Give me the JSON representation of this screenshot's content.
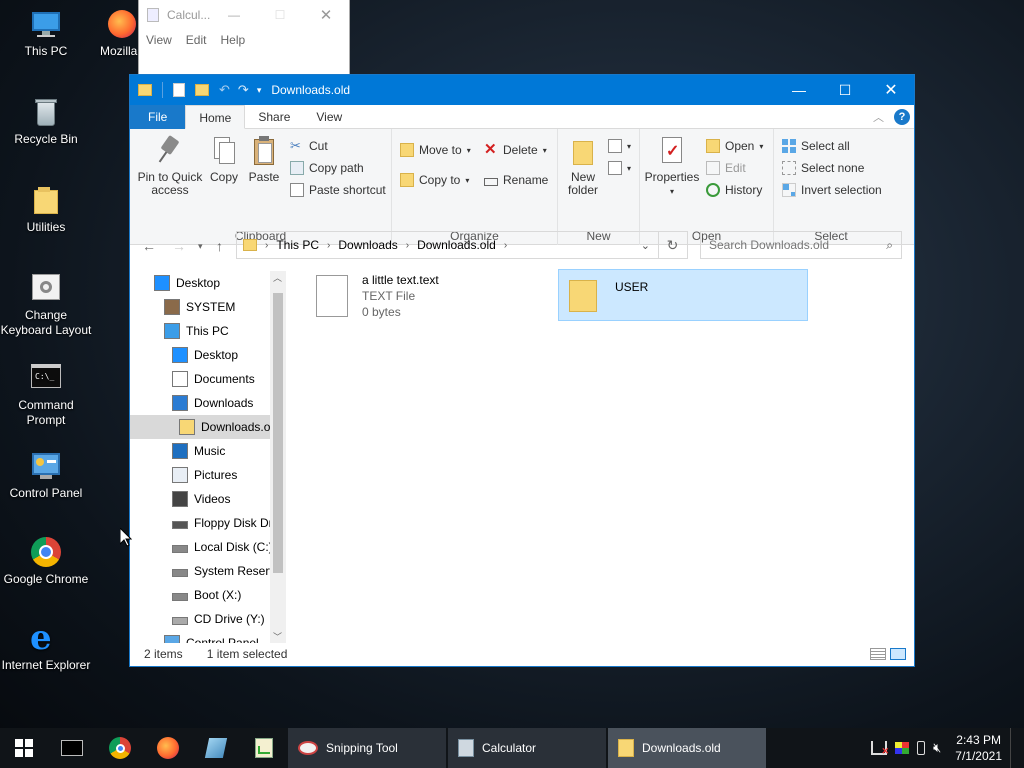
{
  "desktop": {
    "icons": [
      {
        "label": "This PC",
        "icon": "this-pc-icon"
      },
      {
        "label": "Recycle Bin",
        "icon": "recycle-bin-icon"
      },
      {
        "label": "Utilities",
        "icon": "folder-icon"
      },
      {
        "label": "Change Keyboard Layout",
        "icon": "keyboard-settings-icon"
      },
      {
        "label": "Command Prompt",
        "icon": "command-prompt-icon"
      },
      {
        "label": "Control Panel",
        "icon": "control-panel-icon"
      },
      {
        "label": "Google Chrome",
        "icon": "chrome-icon"
      },
      {
        "label": "Internet Explorer",
        "icon": "internet-explorer-icon"
      },
      {
        "label": "Mozilla",
        "icon": "firefox-icon"
      }
    ]
  },
  "calculator_window": {
    "title": "Calcul...",
    "menu": [
      "View",
      "Edit",
      "Help"
    ]
  },
  "explorer": {
    "title": "Downloads.old",
    "tabs": [
      "File",
      "Home",
      "Share",
      "View"
    ],
    "ribbon": {
      "clipboard": {
        "label": "Clipboard",
        "pin": "Pin to Quick access",
        "copy": "Copy",
        "paste": "Paste",
        "cut": "Cut",
        "copy_path": "Copy path",
        "paste_shortcut": "Paste shortcut"
      },
      "organize": {
        "label": "Organize",
        "move_to": "Move to",
        "copy_to": "Copy to",
        "delete": "Delete",
        "rename": "Rename"
      },
      "new": {
        "label": "New",
        "new_folder": "New folder"
      },
      "open": {
        "label": "Open",
        "properties": "Properties",
        "open": "Open",
        "edit": "Edit",
        "history": "History"
      },
      "select": {
        "label": "Select",
        "select_all": "Select all",
        "select_none": "Select none",
        "invert": "Invert selection"
      }
    },
    "address": {
      "crumbs": [
        "This PC",
        "Downloads",
        "Downloads.old"
      ],
      "search_placeholder": "Search Downloads.old"
    },
    "nav": [
      {
        "label": "Desktop",
        "indent": 0,
        "icon": "desktop-icon"
      },
      {
        "label": "SYSTEM",
        "indent": 1,
        "icon": "user-icon"
      },
      {
        "label": "This PC",
        "indent": 1,
        "icon": "this-pc-icon"
      },
      {
        "label": "Desktop",
        "indent": 2,
        "icon": "desktop-icon"
      },
      {
        "label": "Documents",
        "indent": 2,
        "icon": "documents-icon"
      },
      {
        "label": "Downloads",
        "indent": 2,
        "icon": "downloads-icon"
      },
      {
        "label": "Downloads.o",
        "indent": 3,
        "icon": "folder-icon",
        "selected": true
      },
      {
        "label": "Music",
        "indent": 2,
        "icon": "music-icon"
      },
      {
        "label": "Pictures",
        "indent": 2,
        "icon": "pictures-icon"
      },
      {
        "label": "Videos",
        "indent": 2,
        "icon": "videos-icon"
      },
      {
        "label": "Floppy Disk Dri",
        "indent": 2,
        "icon": "floppy-icon"
      },
      {
        "label": "Local Disk (C:)",
        "indent": 2,
        "icon": "drive-icon"
      },
      {
        "label": "System Reserve",
        "indent": 2,
        "icon": "drive-icon"
      },
      {
        "label": "Boot (X:)",
        "indent": 2,
        "icon": "drive-icon"
      },
      {
        "label": "CD Drive (Y:)",
        "indent": 2,
        "icon": "cd-drive-icon"
      },
      {
        "label": "Control Panel",
        "indent": 1,
        "icon": "control-panel-icon"
      }
    ],
    "files": [
      {
        "name": "a little text.text",
        "type": "TEXT File",
        "size": "0 bytes",
        "icon": "text-file-icon"
      },
      {
        "name": "USER",
        "type": "",
        "size": "",
        "icon": "folder-icon",
        "selected": true
      }
    ],
    "status": {
      "items": "2 items",
      "selected": "1 item selected"
    }
  },
  "taskbar": {
    "apps": [
      {
        "label": "Snipping Tool",
        "icon": "snipping-tool-icon"
      },
      {
        "label": "Calculator",
        "icon": "calculator-icon"
      },
      {
        "label": "Downloads.old",
        "icon": "folder-icon",
        "active": true
      }
    ],
    "clock": {
      "time": "2:43 PM",
      "date": "7/1/2021"
    }
  }
}
